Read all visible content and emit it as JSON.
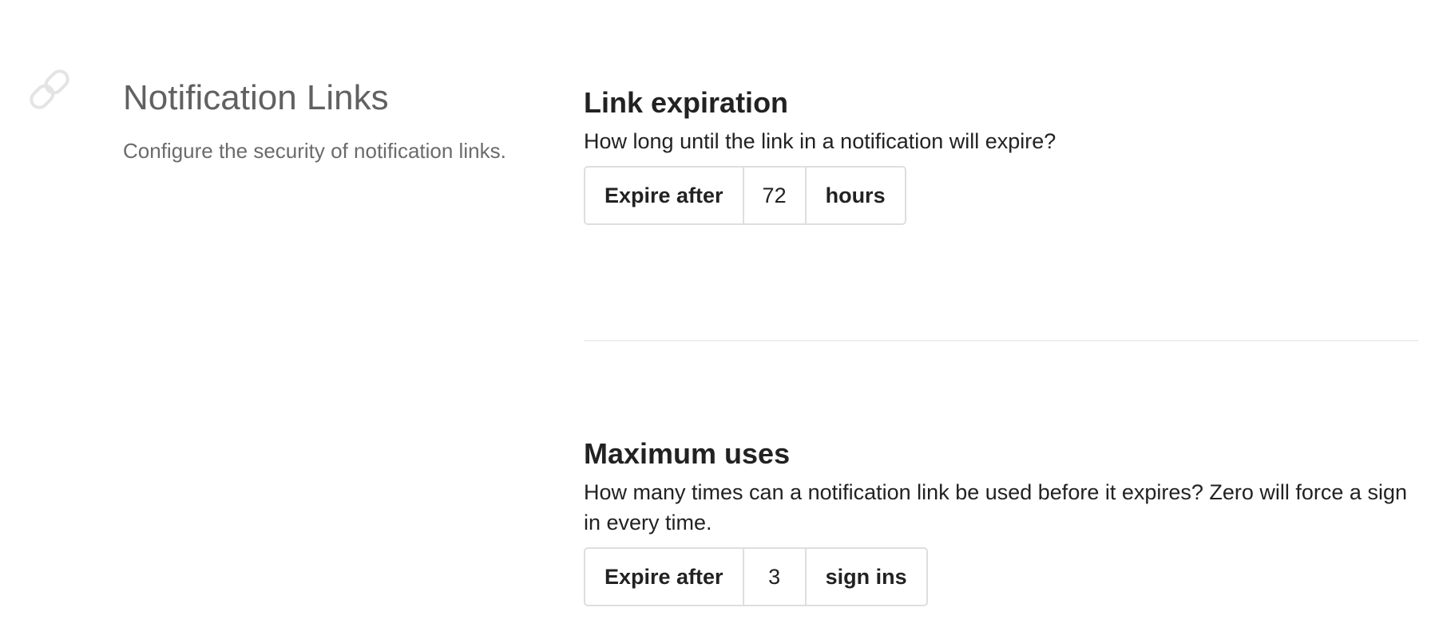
{
  "section": {
    "icon": "link-icon",
    "title": "Notification Links",
    "description": "Configure the security of notification links."
  },
  "link_expiration": {
    "heading": "Link expiration",
    "description": "How long until the link in a notification will expire?",
    "prefix": "Expire after",
    "value": "72",
    "suffix": "hours"
  },
  "maximum_uses": {
    "heading": "Maximum uses",
    "description": "How many times can a notification link be used before it expires? Zero will force a sign in every time.",
    "prefix": "Expire after",
    "value": "3",
    "suffix": "sign ins"
  }
}
